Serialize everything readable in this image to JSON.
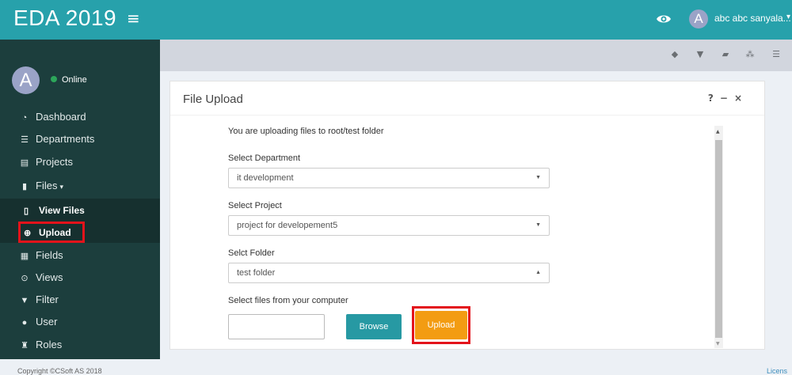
{
  "app": {
    "title": "EDA 2019",
    "menu_icon": "hamburger-icon",
    "user_avatar_letter": "A",
    "user_name": "abc abc sanyala...",
    "accent_color": "#27a1ab"
  },
  "sidebar": {
    "avatar_letter": "A",
    "status": "Online",
    "items": [
      {
        "label": "Dashboard",
        "icon": "dashboard-icon"
      },
      {
        "label": "Departments",
        "icon": "list-icon"
      },
      {
        "label": "Projects",
        "icon": "projects-icon"
      },
      {
        "label": "Files",
        "icon": "file-icon"
      },
      {
        "label": "Fields",
        "icon": "fields-icon"
      },
      {
        "label": "Views",
        "icon": "eye-circle-icon"
      },
      {
        "label": "Filter",
        "icon": "filter-icon"
      },
      {
        "label": "User",
        "icon": "user-icon"
      },
      {
        "label": "Roles",
        "icon": "roles-icon"
      }
    ],
    "subitems": [
      {
        "label": "View Files",
        "icon": "file-outline-icon"
      },
      {
        "label": "Upload",
        "icon": "upload-circle-icon"
      }
    ]
  },
  "toolbar": {
    "icons": [
      "tag-icon",
      "filter-icon",
      "folder-open-icon",
      "sitemap-icon",
      "list-icon"
    ]
  },
  "panel": {
    "title": "File Upload",
    "info": "You are uploading files to root/test folder",
    "department_label": "Select Department",
    "department_value": "it development",
    "project_label": "Select Project",
    "project_value": "project for developement5",
    "folder_label": "Selct Folder",
    "folder_value": "test folder",
    "files_label": "Select files from your computer",
    "browse_label": "Browse",
    "upload_label": "Upload"
  },
  "footer": {
    "copyright": "Copyright ©CSoft AS 2018",
    "right": "Licens"
  }
}
